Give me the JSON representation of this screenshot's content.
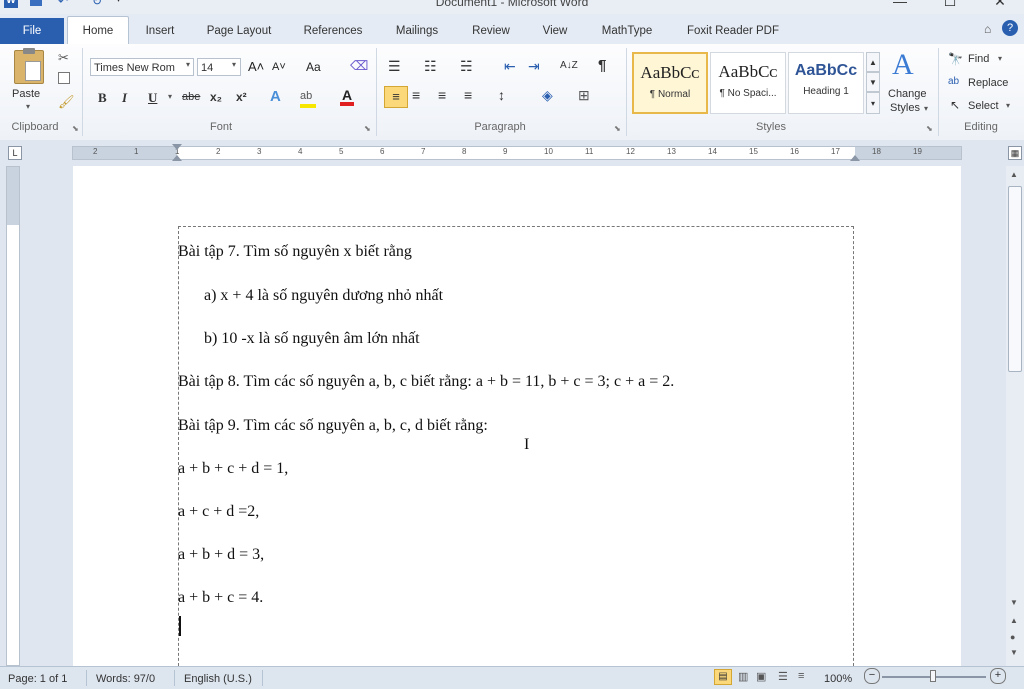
{
  "window": {
    "title": "Document1 - Microsoft Word",
    "minimize_glyph": "—",
    "maximize_glyph": "☐",
    "close_glyph": "✕"
  },
  "tabs": [
    {
      "label": "File"
    },
    {
      "label": "Home"
    },
    {
      "label": "Insert"
    },
    {
      "label": "Page Layout"
    },
    {
      "label": "References"
    },
    {
      "label": "Mailings"
    },
    {
      "label": "Review"
    },
    {
      "label": "View"
    },
    {
      "label": "MathType"
    },
    {
      "label": "Foxit Reader PDF"
    }
  ],
  "clipboard": {
    "paste_label": "Paste",
    "group_label": "Clipboard"
  },
  "font": {
    "font_name": "Times New Rom",
    "font_size": "14",
    "grow_glyph": "A˄",
    "shrink_glyph": "A˅",
    "case_glyph": "Aa",
    "bold": "B",
    "italic": "I",
    "underline": "U",
    "strike": "abe",
    "subscript": "x₂",
    "superscript": "x²",
    "group_label": "Font"
  },
  "paragraph": {
    "pilcrow": "¶",
    "sort_glyph": "A↓Z",
    "group_label": "Paragraph"
  },
  "styles": {
    "items": [
      {
        "preview": "AaBbCᴄ",
        "name": "¶ Normal"
      },
      {
        "preview": "AaBbCᴄ",
        "name": "¶ No Spaci..."
      },
      {
        "preview": "AaBbCᴄ",
        "name": "Heading 1"
      }
    ],
    "change_styles_line1": "Change",
    "change_styles_line2": "Styles",
    "group_label": "Styles"
  },
  "editing": {
    "find_label": "Find",
    "replace_label": "Replace",
    "select_label": "Select",
    "group_label": "Editing"
  },
  "ruler": {
    "numbers": [
      "2",
      "1",
      "1",
      "2",
      "3",
      "4",
      "5",
      "6",
      "7",
      "8",
      "9",
      "10",
      "11",
      "12",
      "13",
      "14",
      "15",
      "16",
      "17",
      "18",
      "19"
    ]
  },
  "document": {
    "lines": [
      "Bài tập 7. Tìm số nguyên x biết rằng",
      "a)  x + 4 là số  nguyên dương nhỏ nhất",
      "b)  10 -x là số nguyên âm lớn nhất",
      "Bài tập 8. Tìm các số nguyên a, b, c biết rằng: a + b = 11, b + c = 3; c + a = 2.",
      "Bài tập 9. Tìm  các số nguyên a, b, c, d biết rằng:",
      "a + b + c + d = 1,",
      "a + c + d =2,",
      "a + b + d = 3,",
      "a + b + c = 4."
    ]
  },
  "status": {
    "page": "Page: 1 of 1",
    "words": "Words: 97/0",
    "language": "English (U.S.)",
    "zoom": "100%",
    "zoom_minus": "−",
    "zoom_plus": "+"
  },
  "colors": {
    "file_tab": "#2a5fb0",
    "ribbon_bg": "#eef2f7",
    "highlight_yellow": "#f7e600",
    "font_red": "#e02020"
  }
}
